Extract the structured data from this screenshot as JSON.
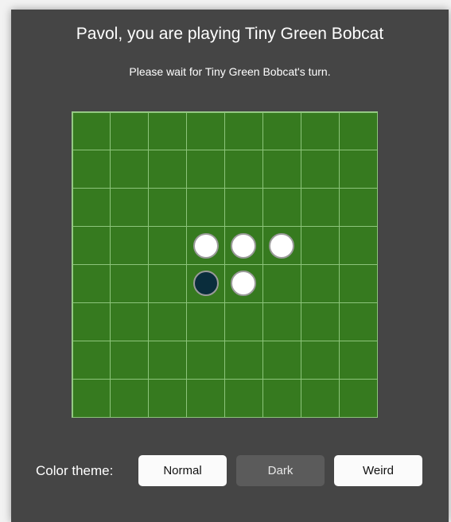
{
  "game": {
    "title": "Pavol, you are playing Tiny Green Bobcat",
    "status": "Please wait for Tiny Green Bobcat's turn.",
    "board": {
      "size": 8,
      "pieces": [
        {
          "row": 3,
          "col": 3,
          "color": "white"
        },
        {
          "row": 3,
          "col": 4,
          "color": "white"
        },
        {
          "row": 3,
          "col": 5,
          "color": "white"
        },
        {
          "row": 4,
          "col": 3,
          "color": "black"
        },
        {
          "row": 4,
          "col": 4,
          "color": "white"
        }
      ]
    }
  },
  "theme": {
    "label": "Color theme:",
    "buttons": [
      {
        "label": "Normal",
        "active": false
      },
      {
        "label": "Dark",
        "active": true
      },
      {
        "label": "Weird",
        "active": false
      }
    ]
  },
  "colors": {
    "background": "#f2f2f2",
    "panel": "#454545",
    "board_green": "#367a1f",
    "grid_line": "#8cc47a",
    "disc_white": "#ffffff",
    "disc_black": "#0a2d3c",
    "disc_border": "#9a9a9a",
    "button_light": "#fbfbfb",
    "button_active": "#5b5b5b"
  }
}
